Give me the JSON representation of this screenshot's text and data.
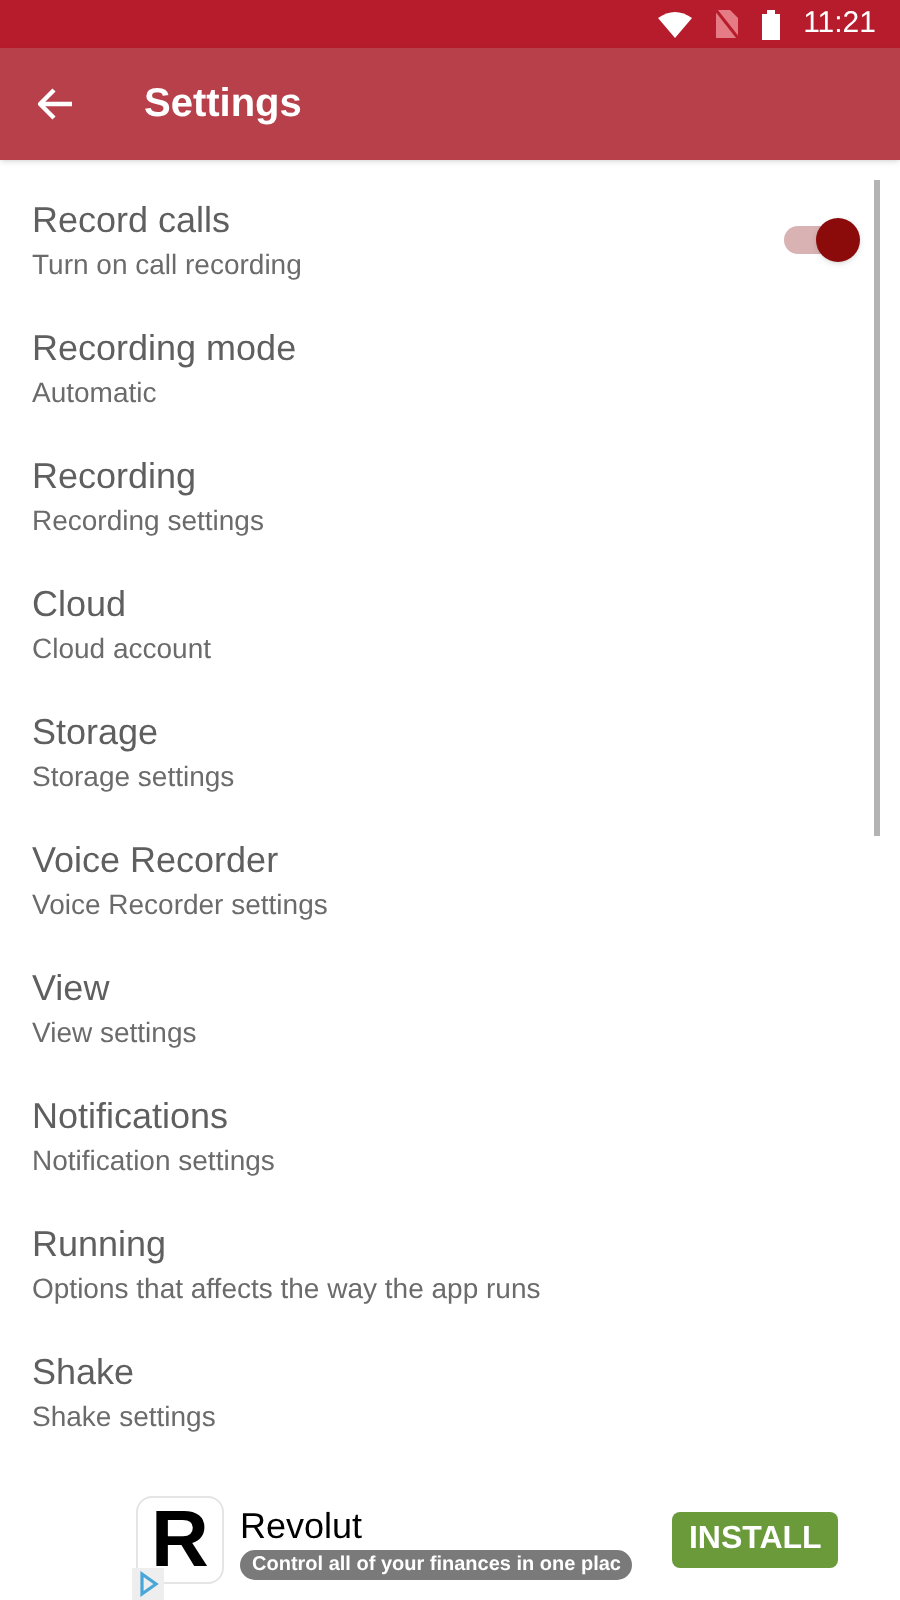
{
  "status_bar": {
    "time": "11:21"
  },
  "app_bar": {
    "title": "Settings"
  },
  "settings": [
    {
      "kind": "switch",
      "title": "Record calls",
      "subtitle": "Turn on call recording",
      "on": true
    },
    {
      "kind": "plain",
      "title": "Recording mode",
      "subtitle": "Automatic"
    },
    {
      "kind": "plain",
      "title": "Recording",
      "subtitle": "Recording settings"
    },
    {
      "kind": "plain",
      "title": "Cloud",
      "subtitle": "Cloud account"
    },
    {
      "kind": "plain",
      "title": "Storage",
      "subtitle": "Storage settings"
    },
    {
      "kind": "plain",
      "title": "Voice Recorder",
      "subtitle": "Voice Recorder settings"
    },
    {
      "kind": "plain",
      "title": "View",
      "subtitle": "View settings"
    },
    {
      "kind": "plain",
      "title": "Notifications",
      "subtitle": "Notification settings"
    },
    {
      "kind": "plain",
      "title": "Running",
      "subtitle": "Options that affects the way the app runs"
    },
    {
      "kind": "plain",
      "title": "Shake",
      "subtitle": "Shake settings"
    }
  ],
  "ad": {
    "logo_letter": "R",
    "name": "Revolut",
    "tagline": "Control all of your finances in one plac",
    "button": "INSTALL"
  }
}
